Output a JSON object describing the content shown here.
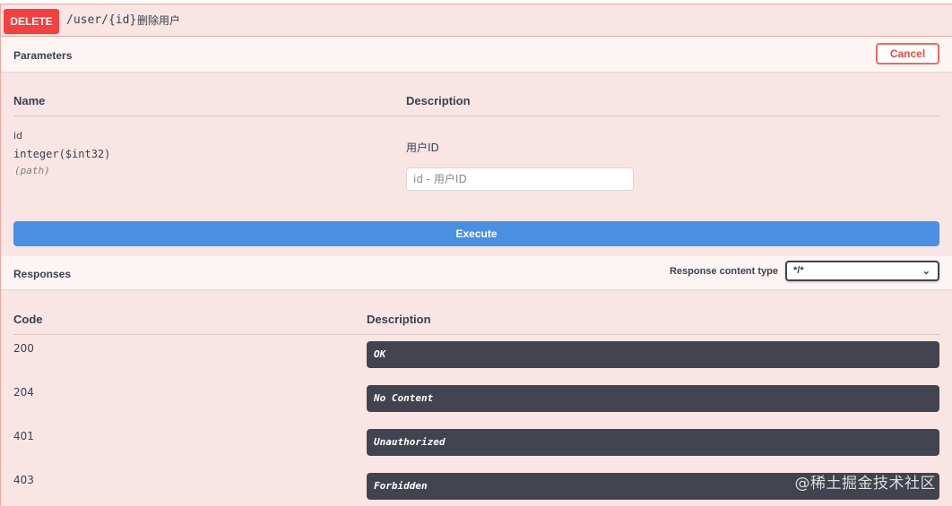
{
  "operation": {
    "method": "DELETE",
    "path": "/user/{id}",
    "summary": "删除用户"
  },
  "parameters": {
    "title": "Parameters",
    "cancel_label": "Cancel",
    "col_name": "Name",
    "col_description": "Description",
    "items": [
      {
        "name": "id",
        "type": "integer($int32)",
        "in": "(path)",
        "description": "用户ID",
        "input_value": "",
        "input_placeholder": "id - 用户ID"
      }
    ]
  },
  "execute_label": "Execute",
  "responses": {
    "title": "Responses",
    "content_type_label": "Response content type",
    "content_type_value": "*/*",
    "col_code": "Code",
    "col_description": "Description",
    "items": [
      {
        "code": "200",
        "description": "OK"
      },
      {
        "code": "204",
        "description": "No Content"
      },
      {
        "code": "401",
        "description": "Unauthorized"
      },
      {
        "code": "403",
        "description": "Forbidden"
      }
    ]
  },
  "watermark": "@稀土掘金技术社区",
  "colors": {
    "delete_red": "#f93e3e",
    "block_bg": "#f9e5e3",
    "execute_blue": "#4990e2",
    "response_dark": "#41444e"
  },
  "icons": {
    "select_chevron": "chevron-down-icon"
  }
}
